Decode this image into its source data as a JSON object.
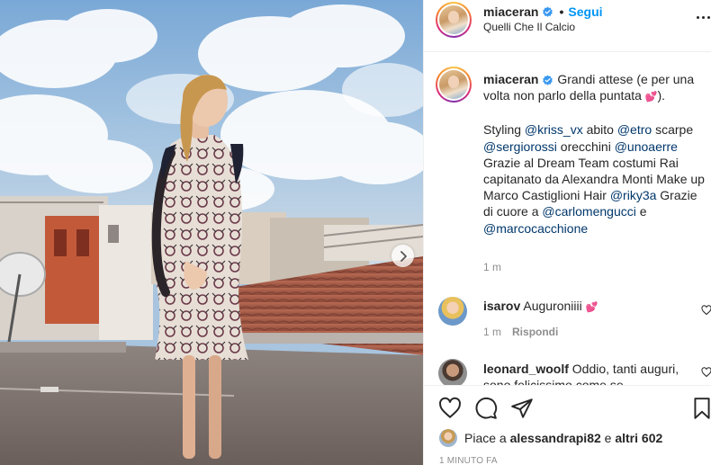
{
  "header": {
    "username": "miaceran",
    "verified": true,
    "separator": "•",
    "follow_label": "Segui",
    "location": "Quelli Che Il Calcio",
    "more_icon": "more-options-icon"
  },
  "caption": {
    "username": "miaceran",
    "line1_text": "Grandi attese (e per una volta non parlo della puntata ",
    "line1_emoji": "💕",
    "line1_end": ").",
    "styling_prefix": "Styling",
    "mention_kriss": "@kriss_vx",
    "abito_word": "abito",
    "mention_etro": "@etro",
    "scarpe_word": "scarpe",
    "mention_sergio": "@sergiorossi",
    "orecchini_word": "orecchini",
    "mention_unoa": "@unoaerre",
    "grazie_line": "Grazie al Dream Team costumi Rai capitanato da Alexandra Monti Make up Marco Castiglioni Hair",
    "mention_riky": "@riky3a",
    "grazie_cuore": "Grazie di cuore a",
    "mention_carlo": "@carlomengucci",
    "and_word": "e",
    "mention_marco": "@marcocacchione",
    "time": "1 m"
  },
  "comments": [
    {
      "username": "isarov",
      "text": "Auguroniiii",
      "emoji": "💕",
      "time": "1 m",
      "reply_label": "Rispondi"
    },
    {
      "username": "leonard_woolf",
      "text": "Oddio, tanti",
      "overflow_text": "auguri, sono felicissimo come se"
    }
  ],
  "actions": {
    "like_icon": "heart-icon",
    "comment_icon": "comment-icon",
    "share_icon": "share-icon",
    "save_icon": "bookmark-icon"
  },
  "likes": {
    "prefix": "Piace a",
    "user": "alessandrapi82",
    "middle": "e",
    "others": "altri 602"
  },
  "post_time": "1 MINUTO FA",
  "colors": {
    "link_blue": "#0095f6",
    "mention_blue": "#00376b",
    "text": "#262626",
    "muted": "#8e8e8e",
    "border": "#efefef"
  }
}
